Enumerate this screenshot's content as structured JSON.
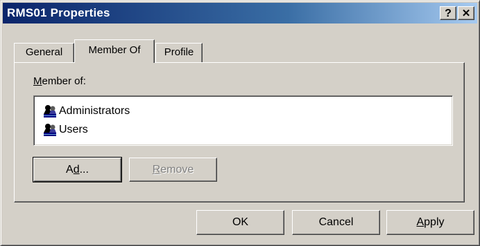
{
  "window": {
    "title": "RMS01 Properties",
    "help_button": "?",
    "close_button": "✕"
  },
  "tabs": [
    {
      "label": "General",
      "active": false
    },
    {
      "label": "Member Of",
      "active": true
    },
    {
      "label": "Profile",
      "active": false
    }
  ],
  "member_of": {
    "label_prefix": "",
    "label_accel": "M",
    "label_rest": "ember of:",
    "items": [
      {
        "label": "Administrators",
        "icon": "group-icon"
      },
      {
        "label": "Users",
        "icon": "group-icon"
      }
    ],
    "add_button": {
      "pre": "A",
      "accel": "d",
      "post": "d..."
    },
    "remove_button": {
      "pre": "",
      "accel": "R",
      "post": "emove"
    }
  },
  "footer": {
    "ok_label": "OK",
    "cancel_label": "Cancel",
    "apply_accel": "A",
    "apply_rest": "pply"
  }
}
